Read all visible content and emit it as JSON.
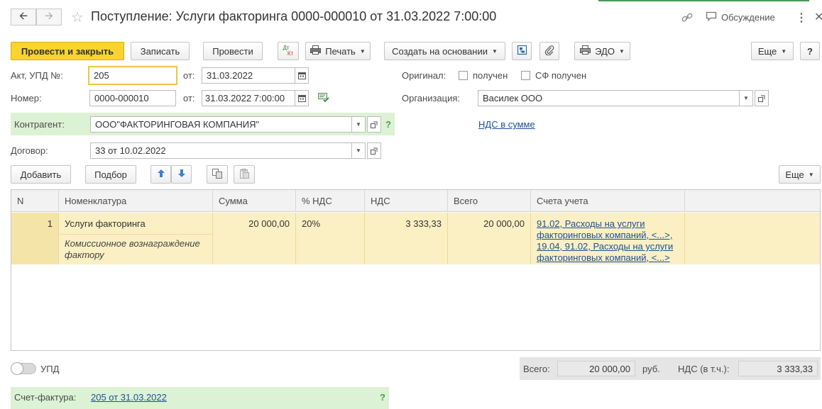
{
  "window": {
    "title": "Поступление: Услуги факторинга 0000-000010 от 31.03.2022 7:00:00",
    "discuss_label": "Обсуждение"
  },
  "toolbar": {
    "post_close": "Провести и закрыть",
    "save": "Записать",
    "post": "Провести",
    "dtkt_dt": "Дт",
    "dtkt_kt": "Кт",
    "print": "Печать",
    "create_based": "Создать на основании",
    "edo": "ЭДО",
    "more": "Еще",
    "help": "?"
  },
  "form": {
    "act_label": "Акт, УПД №:",
    "act_value": "205",
    "from_label": "от:",
    "act_date": "31.03.2022",
    "number_label": "Номер:",
    "number_value": "0000-000010",
    "number_date": "31.03.2022  7:00:00",
    "original_label": "Оригинал:",
    "received_label": "получен",
    "sf_received_label": "СФ получен",
    "org_label": "Организация:",
    "org_value": "Василек ООО",
    "counterparty_label": "Контрагент:",
    "counterparty_value": "ООО\"ФАКТОРИНГОВАЯ КОМПАНИЯ\"",
    "counterparty_help": "?",
    "vat_link": "НДС в сумме",
    "contract_label": "Договор:",
    "contract_value": "33 от 10.02.2022"
  },
  "table_toolbar": {
    "add": "Добавить",
    "pick": "Подбор",
    "more": "Еще"
  },
  "table": {
    "columns": [
      "N",
      "Номенклатура",
      "Сумма",
      "% НДС",
      "НДС",
      "Всего",
      "Счета учета"
    ],
    "rows": [
      {
        "n": "1",
        "item": "Услуги факторинга",
        "item_comment": "Комиссионное вознаграждение фактору",
        "amount": "20 000,00",
        "vat_rate": "20%",
        "vat": "3 333,33",
        "total": "20 000,00",
        "accounts": [
          "91.02, Расходы на услуги",
          "факторинговых компаний, <...>,",
          "19.04, 91.02, Расходы на услуги",
          "факторинговых компаний, <...>"
        ]
      }
    ]
  },
  "footer": {
    "upd_label": "УПД",
    "total_label": "Всего:",
    "total_value": "20 000,00",
    "currency": "руб.",
    "vat_label": "НДС (в т.ч.):",
    "vat_value": "3 333,33",
    "invoice_label": "Счет-фактура:",
    "invoice_link": "205 от 31.03.2022",
    "invoice_help": "?"
  },
  "colors": {
    "primary_button": "#f9d431",
    "green_bar": "#dcf2d4",
    "selected_row": "#fbf0c4",
    "link": "#1c4f98"
  },
  "icons": [
    "back-arrow-icon",
    "forward-arrow-icon",
    "star-icon",
    "link-icon",
    "chat-icon",
    "kebab-icon",
    "close-icon",
    "dtkt-icon",
    "printer-icon",
    "structure-icon",
    "paperclip-icon",
    "edo-icon",
    "calendar-icon",
    "message-check-icon",
    "open-icon",
    "arrow-up-icon",
    "arrow-down-icon",
    "copy-icon",
    "paste-icon",
    "chevron-down-icon"
  ]
}
